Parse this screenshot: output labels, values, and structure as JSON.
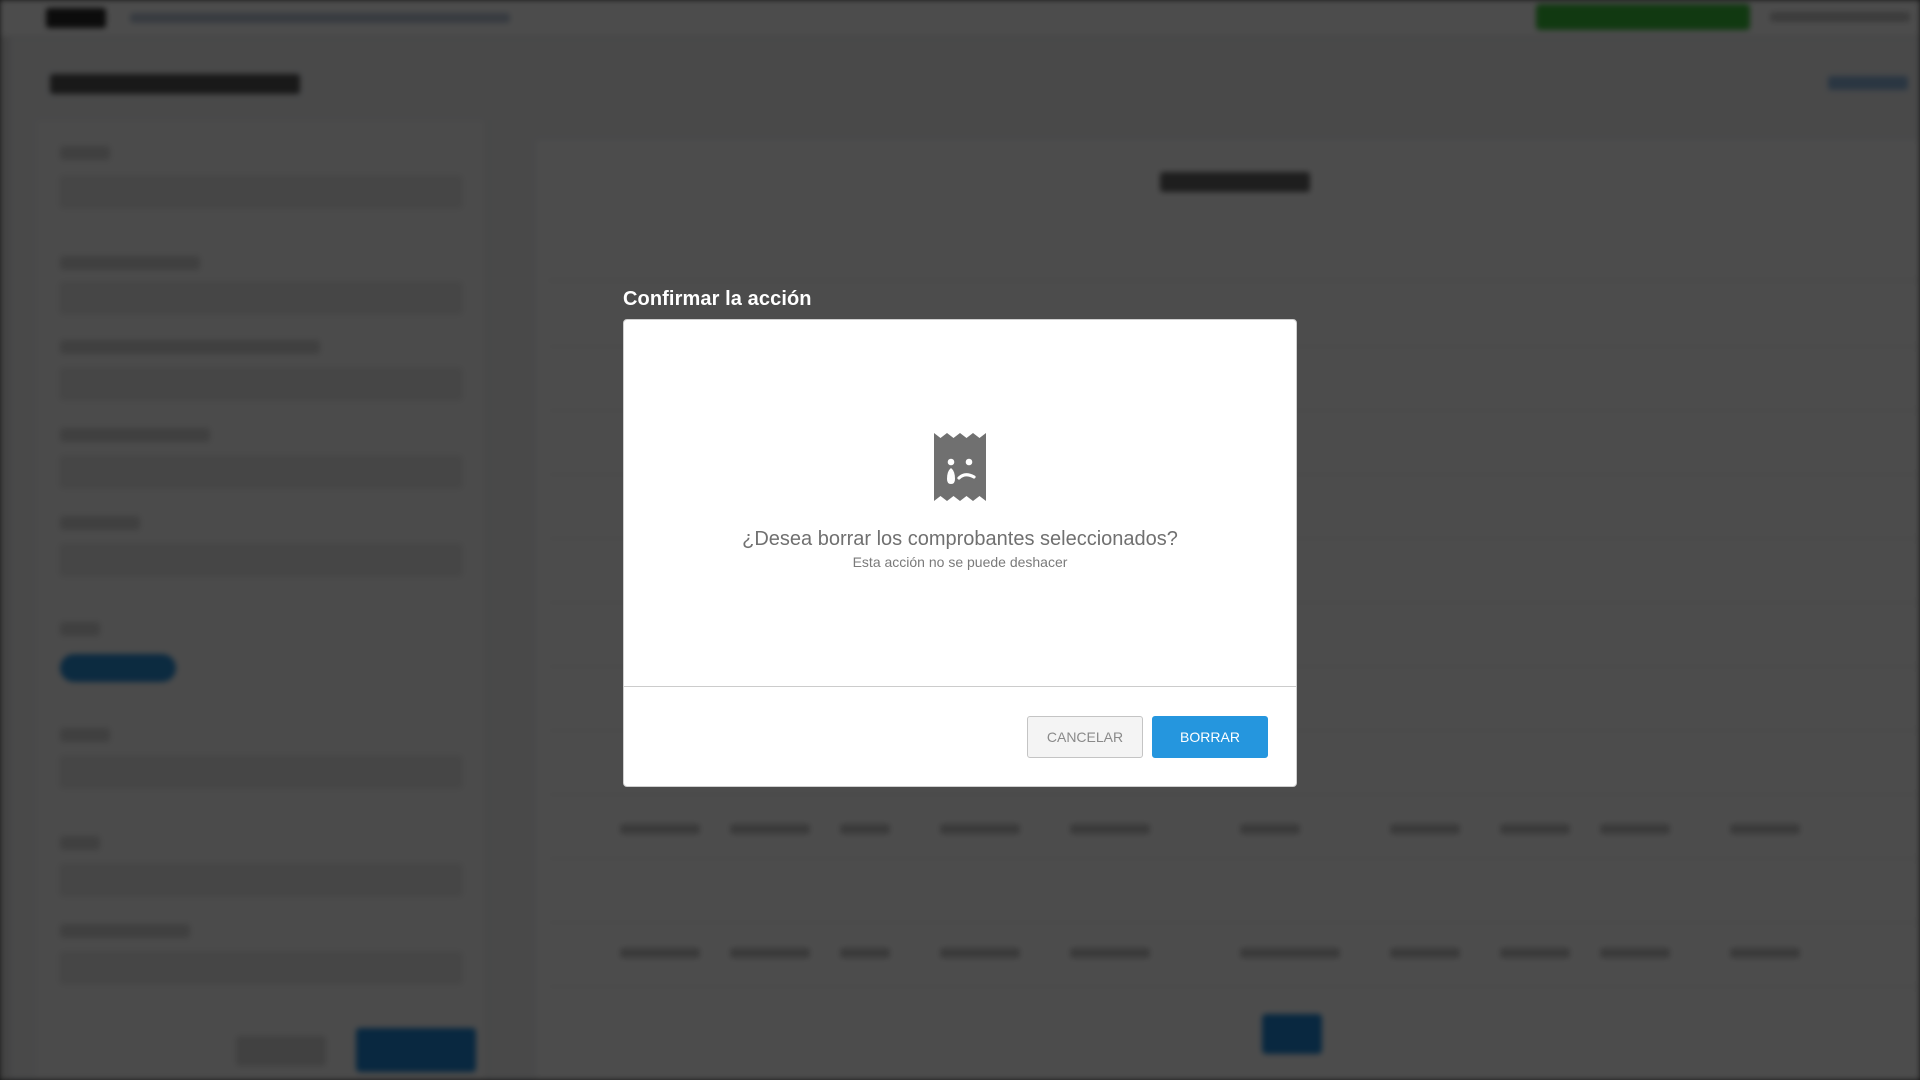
{
  "dialog": {
    "title": "Confirmar la acción",
    "icon": "sad-receipt-icon",
    "question": "¿Desea borrar los comprobantes seleccionados?",
    "subtext": "Esta acción no se puede deshacer",
    "cancel_label": "CANCELAR",
    "confirm_label": "BORRAR"
  },
  "colors": {
    "primary": "#2596de",
    "overlay": "rgba(0,0,0,0.70)",
    "icon": "#707070"
  }
}
